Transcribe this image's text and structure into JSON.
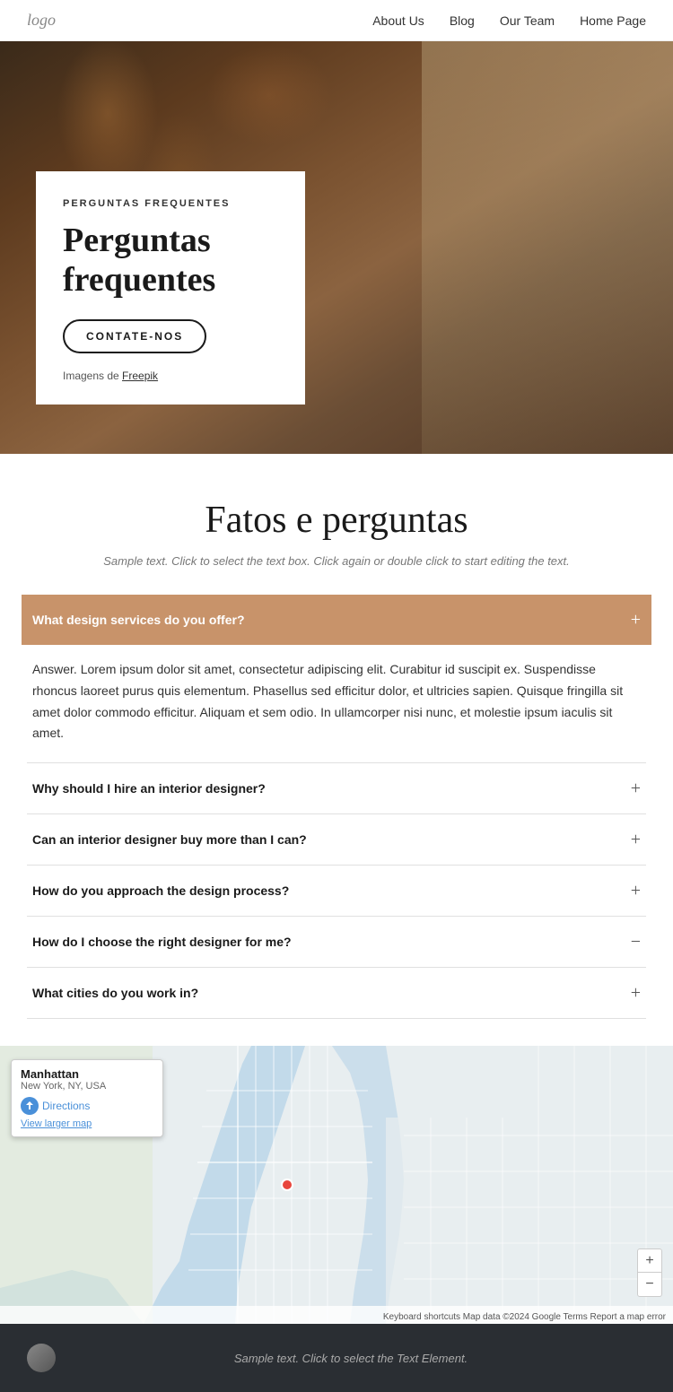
{
  "nav": {
    "logo": "logo",
    "links": [
      {
        "label": "About Us",
        "id": "about-us"
      },
      {
        "label": "Blog",
        "id": "blog"
      },
      {
        "label": "Our Team",
        "id": "our-team"
      },
      {
        "label": "Home Page",
        "id": "home-page"
      }
    ]
  },
  "hero": {
    "card_label": "PERGUNTAS FREQUENTES",
    "card_title": "Perguntas frequentes",
    "button_label": "CONTATE-NOS",
    "credit_prefix": "Imagens de ",
    "credit_link": "Freepik"
  },
  "faq": {
    "main_title": "Fatos e perguntas",
    "subtitle": "Sample text. Click to select the text box. Click again or double click to start editing the text.",
    "items": [
      {
        "question": "What design services do you offer?",
        "active": true,
        "answer": "Answer. Lorem ipsum dolor sit amet, consectetur adipiscing elit. Curabitur id suscipit ex. Suspendisse rhoncus laoreet purus quis elementum. Phasellus sed efficitur dolor, et ultricies sapien. Quisque fringilla sit amet dolor commodo efficitur. Aliquam et sem odio. In ullamcorper nisi nunc, et molestie ipsum iaculis sit amet."
      },
      {
        "question": "Why should I hire an interior designer?",
        "active": false,
        "answer": ""
      },
      {
        "question": "Can an interior designer buy more than I can?",
        "active": false,
        "answer": ""
      },
      {
        "question": "How do you approach the design process?",
        "active": false,
        "answer": ""
      },
      {
        "question": "How do I choose the right designer for me?",
        "active": false,
        "answer": ""
      },
      {
        "question": "What cities do you work in?",
        "active": false,
        "answer": ""
      }
    ]
  },
  "map": {
    "location_title": "Manhattan",
    "location_subtitle": "New York, NY, USA",
    "directions_label": "Directions",
    "larger_map_label": "View larger map",
    "zoom_in": "+",
    "zoom_out": "−",
    "attribution": "Keyboard shortcuts  Map data ©2024 Google  Terms  Report a map error"
  },
  "footer": {
    "text": "Sample text. Click to select the Text Element."
  },
  "colors": {
    "faq_active_bg": "#c8936a",
    "nav_link": "#333333",
    "footer_bg": "#2a2e33"
  }
}
